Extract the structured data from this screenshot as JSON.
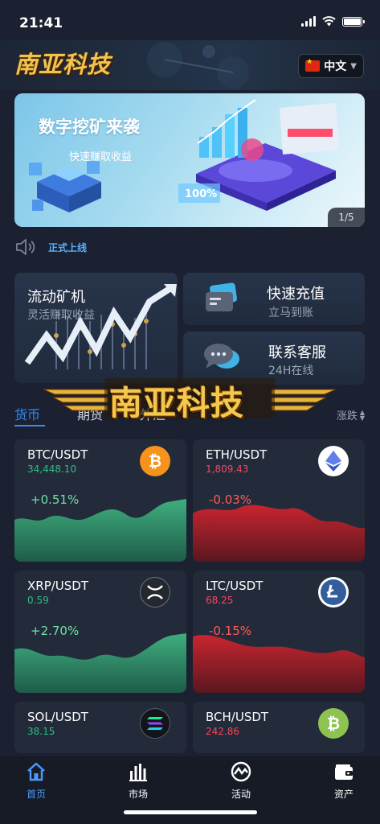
{
  "status_bar": {
    "time": "21:41"
  },
  "header": {
    "logo_text": "南亚科技",
    "language": "中文"
  },
  "banner": {
    "title": "数字挖矿来袭",
    "subtitle": "快速赚取收益",
    "page_indicator": "1/5"
  },
  "notice": {
    "text": "正式上线"
  },
  "features": {
    "mining": {
      "title": "流动矿机",
      "subtitle": "灵活赚取收益"
    },
    "recharge": {
      "title": "快速充值",
      "subtitle": "立马到账"
    },
    "service": {
      "title": "联系客服",
      "subtitle": "24H在线"
    }
  },
  "watermark": {
    "text": "南亚科技"
  },
  "market_tabs": {
    "tabs": [
      "货币",
      "期货",
      "外汇"
    ],
    "active": "货币",
    "sort_label": "涨跌"
  },
  "markets": [
    {
      "pair": "BTC/USDT",
      "price": "34,448.10",
      "change": "+0.51%",
      "trend": "up",
      "icon": "bitcoin-icon",
      "icon_color": "#f7931a"
    },
    {
      "pair": "ETH/USDT",
      "price": "1,809.43",
      "change": "-0.03%",
      "trend": "down",
      "icon": "ethereum-icon",
      "icon_color": "#ffffff"
    },
    {
      "pair": "XRP/USDT",
      "price": "0.59",
      "change": "+2.70%",
      "trend": "up",
      "icon": "xrp-icon",
      "icon_color": "#23292f"
    },
    {
      "pair": "LTC/USDT",
      "price": "68.25",
      "change": "-0.15%",
      "trend": "down",
      "icon": "litecoin-icon",
      "icon_color": "#ffffff"
    },
    {
      "pair": "SOL/USDT",
      "price": "38.15",
      "change": "",
      "trend": "up",
      "icon": "solana-icon",
      "icon_color": "#14151a"
    },
    {
      "pair": "BCH/USDT",
      "price": "242.86",
      "change": "",
      "trend": "down",
      "icon": "bitcoin-cash-icon",
      "icon_color": "#8dc351"
    }
  ],
  "tabbar": {
    "items": [
      "首页",
      "市场",
      "活动",
      "资产"
    ],
    "active": "首页"
  },
  "colors": {
    "accent": "#2f8ef7",
    "up": "#2ebd85",
    "down": "#f6465d",
    "background": "#1b2130",
    "card": "#232b3b"
  }
}
